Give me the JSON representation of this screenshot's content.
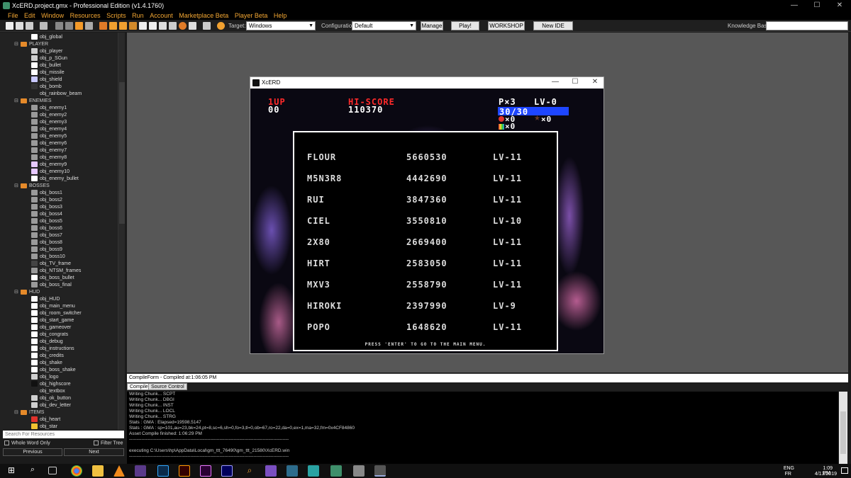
{
  "window": {
    "title": "XcERD.project.gmx  -  Professional Edition (v1.4.1760)",
    "controls": [
      "—",
      "☐",
      "✕"
    ]
  },
  "menu": [
    "File",
    "Edit",
    "Window",
    "Resources",
    "Scripts",
    "Run",
    "Account",
    "Marketplace Beta",
    "Player Beta",
    "Help"
  ],
  "toolbar": {
    "target_label": "Target:",
    "target_value": "Windows",
    "config_label": "Configuration:",
    "config_value": "Default",
    "manage": "Manage",
    "play": "Play!",
    "workshop": "WORKSHOP",
    "new_ide": "New IDE",
    "kb_label": "Knowledge Base:"
  },
  "tree": [
    {
      "t": "obj",
      "label": "obj_global",
      "color": "#ffffff"
    },
    {
      "t": "folder",
      "label": "PLAYER"
    },
    {
      "t": "obj",
      "label": "obj_player",
      "color": "#cfcfcf"
    },
    {
      "t": "obj",
      "label": "obj_p_SGun",
      "color": "#cfcfcf"
    },
    {
      "t": "obj",
      "label": "obj_bullet",
      "color": "#ffffff"
    },
    {
      "t": "obj",
      "label": "obj_missile",
      "color": "#ffffff"
    },
    {
      "t": "obj",
      "label": "obj_shield",
      "color": "#c8c8ff"
    },
    {
      "t": "obj",
      "label": "obj_bomb",
      "color": "#333333"
    },
    {
      "t": "obj",
      "label": "obj_rainbow_beam",
      "color": "#222222"
    },
    {
      "t": "folder",
      "label": "ENEMIES"
    },
    {
      "t": "obj",
      "label": "obj_enemy1",
      "color": "#9a9a9a"
    },
    {
      "t": "obj",
      "label": "obj_enemy2",
      "color": "#9a9a9a"
    },
    {
      "t": "obj",
      "label": "obj_enemy3",
      "color": "#9a9a9a"
    },
    {
      "t": "obj",
      "label": "obj_enemy4",
      "color": "#9a9a9a"
    },
    {
      "t": "obj",
      "label": "obj_enemy5",
      "color": "#9a9a9a"
    },
    {
      "t": "obj",
      "label": "obj_enemy6",
      "color": "#9a9a9a"
    },
    {
      "t": "obj",
      "label": "obj_enemy7",
      "color": "#9a9a9a"
    },
    {
      "t": "obj",
      "label": "obj_enemy8",
      "color": "#9a9a9a"
    },
    {
      "t": "obj",
      "label": "obj_enemy9",
      "color": "#e6c8ff"
    },
    {
      "t": "obj",
      "label": "obj_enemy10",
      "color": "#e6c8ff"
    },
    {
      "t": "obj",
      "label": "obj_enemy_bullet",
      "color": "#ffffff"
    },
    {
      "t": "folder",
      "label": "BOSSES"
    },
    {
      "t": "obj",
      "label": "obj_boss1",
      "color": "#9a9a9a"
    },
    {
      "t": "obj",
      "label": "obj_boss2",
      "color": "#9a9a9a"
    },
    {
      "t": "obj",
      "label": "obj_boss3",
      "color": "#9a9a9a"
    },
    {
      "t": "obj",
      "label": "obj_boss4",
      "color": "#9a9a9a"
    },
    {
      "t": "obj",
      "label": "obj_boss5",
      "color": "#9a9a9a"
    },
    {
      "t": "obj",
      "label": "obj_boss6",
      "color": "#9a9a9a"
    },
    {
      "t": "obj",
      "label": "obj_boss7",
      "color": "#9a9a9a"
    },
    {
      "t": "obj",
      "label": "obj_boss8",
      "color": "#9a9a9a"
    },
    {
      "t": "obj",
      "label": "obj_boss9",
      "color": "#9a9a9a"
    },
    {
      "t": "obj",
      "label": "obj_boss10",
      "color": "#9a9a9a"
    },
    {
      "t": "obj",
      "label": "obj_TV_frame",
      "color": "#444444"
    },
    {
      "t": "obj",
      "label": "obj_NTSM_frames",
      "color": "#9a9a9a"
    },
    {
      "t": "obj",
      "label": "obj_boss_bullet",
      "color": "#ffffff"
    },
    {
      "t": "obj",
      "label": "obj_boss_final",
      "color": "#9a9a9a"
    },
    {
      "t": "folder",
      "label": "HUD"
    },
    {
      "t": "obj",
      "label": "obj_HUD",
      "color": "#ffffff"
    },
    {
      "t": "obj",
      "label": "obj_main_menu",
      "color": "#ffffff"
    },
    {
      "t": "obj",
      "label": "obj_room_switcher",
      "color": "#ffffff"
    },
    {
      "t": "obj",
      "label": "obj_start_game",
      "color": "#ffffff"
    },
    {
      "t": "obj",
      "label": "obj_gameover",
      "color": "#ffffff"
    },
    {
      "t": "obj",
      "label": "obj_congrats",
      "color": "#ffffff"
    },
    {
      "t": "obj",
      "label": "obj_debug",
      "color": "#ffffff"
    },
    {
      "t": "obj",
      "label": "obj_instructions",
      "color": "#ffffff"
    },
    {
      "t": "obj",
      "label": "obj_credits",
      "color": "#ffffff"
    },
    {
      "t": "obj",
      "label": "obj_shake",
      "color": "#ffffff"
    },
    {
      "t": "obj",
      "label": "obj_boss_shake",
      "color": "#ffffff"
    },
    {
      "t": "obj",
      "label": "obj_logo",
      "color": "#cfcfcf"
    },
    {
      "t": "obj",
      "label": "obj_highscore",
      "color": "#111111"
    },
    {
      "t": "obj",
      "label": "obj_textbox",
      "color": "#222222"
    },
    {
      "t": "obj",
      "label": "obj_ok_button",
      "color": "#cfcfcf"
    },
    {
      "t": "obj",
      "label": "obj_dev_letter",
      "color": "#cfcfcf"
    },
    {
      "t": "folder",
      "label": "ITEMS"
    },
    {
      "t": "obj",
      "label": "obj_heart",
      "color": "#e0322c"
    },
    {
      "t": "obj",
      "label": "obj_star",
      "color": "#f2c230"
    }
  ],
  "search": {
    "placeholder": "Search For Resources",
    "whole_word": "Whole Word Only",
    "filter_tree": "Filter Tree",
    "previous": "Previous",
    "next": "Next"
  },
  "game": {
    "title": "XcERD",
    "hud": {
      "one_up": "1UP",
      "one_up_score": "00",
      "hi_label": "HI-SCORE",
      "hi_score": "110370",
      "lives": "P×3",
      "level": "LV-0",
      "power": "30/30",
      "hearts": "×0",
      "stars": "×0",
      "rainbow": "×0"
    },
    "scores": [
      {
        "name": "FLOUR",
        "score": "5660530",
        "level": "LV-11"
      },
      {
        "name": "M5N3R8",
        "score": "4442690",
        "level": "LV-11"
      },
      {
        "name": "RUI",
        "score": "3847360",
        "level": "LV-11"
      },
      {
        "name": "CIEL",
        "score": "3550810",
        "level": "LV-10"
      },
      {
        "name": "2X80",
        "score": "2669400",
        "level": "LV-11"
      },
      {
        "name": "HIRT",
        "score": "2583050",
        "level": "LV-11"
      },
      {
        "name": "MXV3",
        "score": "2558790",
        "level": "LV-11"
      },
      {
        "name": "HIROKI",
        "score": "2397990",
        "level": "LV-9"
      },
      {
        "name": "POPO",
        "score": "1648620",
        "level": "LV-11"
      }
    ],
    "press": "PRESS 'ENTER' TO GO TO THE MAIN MENU."
  },
  "compile": {
    "header": "CompileForm - Compiled at:1:06:05 PM",
    "tabs": [
      "Compile",
      "Source Control"
    ],
    "log": [
      "Writing Chunk... SCPT",
      "Writing Chunk... DBGI",
      "Writing Chunk... INST",
      "Writing Chunk... LOCL",
      "Writing Chunk... STRG",
      "Stats : GMA : Elapsed=19598.5147",
      "Stats : GMA : sp=101,au=23,bk=24,pt=8,sc=6,sh=0,fo=3,tl=0,ob=67,ro=22,da=0,ex=1,ma=32,fm=0x4CF84860",
      "Asset Compile finished: 1:06:29 PM",
      "--------------------------------------------------------------------------------------------------------",
      "",
      "executing C:\\Users\\hp\\AppData\\Local\\gm_ttt_76490\\gm_ttt_21580\\XcERD.win",
      "--------------------------------------------------------------------------------------------------------"
    ]
  },
  "taskbar": {
    "lang1": "ENG",
    "lang2": "FR",
    "time": "1:09 PM",
    "date": "4/13/2019"
  }
}
